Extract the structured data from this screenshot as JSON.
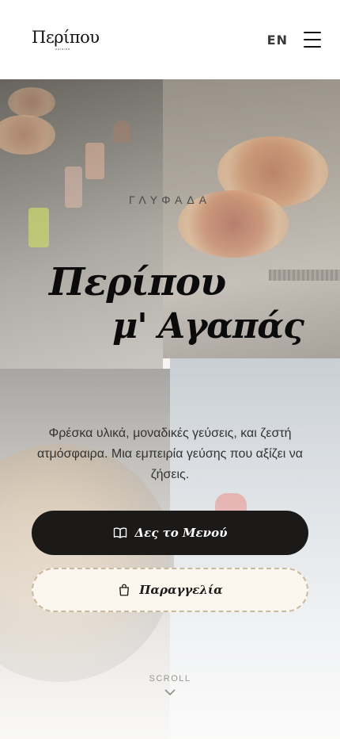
{
  "header": {
    "logo_text": "Περίπου",
    "logo_sub": "cuisine",
    "lang_label": "EN"
  },
  "hero": {
    "location": "ΓΛΥΦΑΔΑ",
    "headline_line1": "Περίπου",
    "headline_line2": "μ' Αγαπάς",
    "description": "Φρέσκα υλικά, μοναδικές γεύσεις, και ζεστή ατμόσφαιρα. Μια εμπειρία γεύσης που αξίζει να ζήσεις.",
    "menu_button_label": "Δες το Μενού",
    "order_button_label": "Παραγγελία",
    "scroll_label": "SCROLL"
  },
  "icons": {
    "menu": "hamburger-menu-icon",
    "book": "book-icon",
    "bag": "shopping-bag-icon",
    "chevron": "chevron-down-icon"
  },
  "colors": {
    "primary_button": "#1c1a19",
    "secondary_button": "#fbf6ee",
    "secondary_border": "#c9b9a0"
  }
}
